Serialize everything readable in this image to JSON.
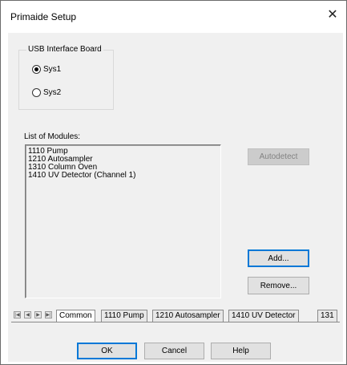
{
  "window": {
    "title": "Primaide Setup",
    "close_glyph": "✕"
  },
  "usb_group": {
    "label": "USB Interface Board",
    "options": [
      {
        "label": "Sys1",
        "selected": true
      },
      {
        "label": "Sys2",
        "selected": false
      }
    ]
  },
  "modules": {
    "label": "List of Modules:",
    "items": [
      "1110 Pump",
      "1210 Autosampler",
      "1310 Column Oven",
      "1410 UV Detector (Channel 1)"
    ]
  },
  "buttons": {
    "autodetect": "Autodetect",
    "add": "Add...",
    "remove": "Remove..."
  },
  "tabs": {
    "nav_glyphs": [
      "|◀",
      "◀",
      "▶",
      "▶|"
    ],
    "items": [
      "Common",
      "1110 Pump",
      "1210 Autosampler",
      "1410 UV Detector",
      "131"
    ],
    "active": "Common"
  },
  "footer": {
    "ok": "OK",
    "cancel": "Cancel",
    "help": "Help"
  }
}
